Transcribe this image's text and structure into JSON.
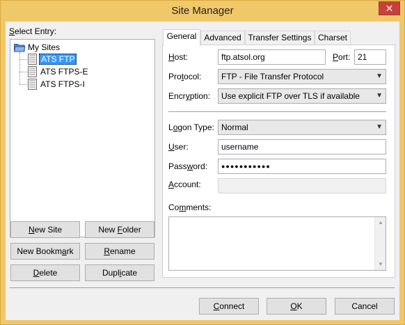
{
  "window": {
    "title": "Site Manager",
    "close_glyph": "✕"
  },
  "left": {
    "select_entry_label_prefix": "S",
    "select_entry_label_rest": "elect Entry:",
    "tree": {
      "root": "My Sites",
      "sites": [
        "ATS FTP",
        "ATS FTPS-E",
        "ATS FTPS-I"
      ],
      "selected_index": 0
    },
    "buttons": {
      "new_site_prefix": "N",
      "new_site_rest": "ew Site",
      "new_folder_pre": "New ",
      "new_folder_u": "F",
      "new_folder_post": "older",
      "new_bookmark_pre": "New Bookm",
      "new_bookmark_u": "a",
      "new_bookmark_post": "rk",
      "rename_u": "R",
      "rename_post": "ename",
      "delete_u": "D",
      "delete_post": "elete",
      "duplicate_pre": "Dupl",
      "duplicate_u": "i",
      "duplicate_post": "cate"
    }
  },
  "tabs": [
    "General",
    "Advanced",
    "Transfer Settings",
    "Charset"
  ],
  "general": {
    "host_label_u": "H",
    "host_label_rest": "ost:",
    "host_value": "ftp.atsol.org",
    "port_label_u": "P",
    "port_label_rest": "ort:",
    "port_value": "21",
    "protocol_label_pre": "Pro",
    "protocol_label_u": "t",
    "protocol_label_post": "ocol:",
    "protocol_value": "FTP - File Transfer Protocol",
    "encryption_label_pre": "Encr",
    "encryption_label_u": "y",
    "encryption_label_post": "ption:",
    "encryption_value": "Use explicit FTP over TLS if available",
    "logon_label_pre": "L",
    "logon_label_u": "o",
    "logon_label_post": "gon Type:",
    "logon_value": "Normal",
    "user_label_u": "U",
    "user_label_rest": "ser:",
    "user_value": "username",
    "password_label_pre": "Pass",
    "password_label_u": "w",
    "password_label_post": "ord:",
    "password_value": "●●●●●●●●●●●",
    "account_label_pre": "A",
    "account_label_u": "c",
    "account_label_post": "count:",
    "account_value": "",
    "comments_label_pre": "Co",
    "comments_label_u": "m",
    "comments_label_post": "ments:"
  },
  "footer": {
    "connect_u": "C",
    "connect_rest": "onnect",
    "ok_u": "O",
    "ok_rest": "K",
    "cancel": "Cancel"
  },
  "colors": {
    "title_bar": "#f0c869",
    "selection": "#3399ff",
    "close_button": "#c7413b"
  }
}
